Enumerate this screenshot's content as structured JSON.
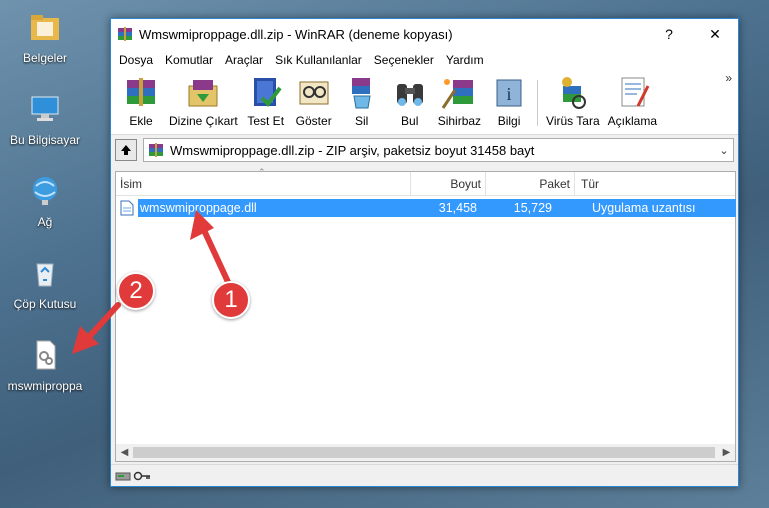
{
  "desktop": {
    "icons": [
      {
        "label": "Belgeler"
      },
      {
        "label": "Bu Bilgisayar"
      },
      {
        "label": "Ağ"
      },
      {
        "label": "Çöp Kutusu"
      },
      {
        "label": "mswmiproppa"
      }
    ]
  },
  "window": {
    "title": "Wmswmiproppage.dll.zip - WinRAR (deneme kopyası)",
    "help_btn": "?",
    "close_btn": "✕",
    "menu": [
      "Dosya",
      "Komutlar",
      "Araçlar",
      "Sık Kullanılanlar",
      "Seçenekler",
      "Yardım"
    ],
    "toolbar": [
      {
        "label": "Ekle",
        "icon": "add-icon"
      },
      {
        "label": "Dizine Çıkart",
        "icon": "extract-icon"
      },
      {
        "label": "Test Et",
        "icon": "test-icon"
      },
      {
        "label": "Göster",
        "icon": "view-icon"
      },
      {
        "label": "Sil",
        "icon": "delete-icon"
      },
      {
        "label": "Bul",
        "icon": "find-icon"
      },
      {
        "label": "Sihirbaz",
        "icon": "wizard-icon"
      },
      {
        "label": "Bilgi",
        "icon": "info-icon"
      },
      {
        "label": "Virüs Tara",
        "icon": "virus-scan-icon"
      },
      {
        "label": "Açıklama",
        "icon": "comment-icon"
      }
    ],
    "toolbar_more": "»",
    "address": "Wmswmiproppage.dll.zip - ZIP arşiv, paketsiz boyut 31458 bayt",
    "columns": {
      "name": "İsim",
      "size": "Boyut",
      "packed": "Paket",
      "type": "Tür"
    },
    "files": [
      {
        "name": "wmswmiproppage.dll",
        "size": "31,458",
        "packed": "15,729",
        "type": "Uygulama uzantısı"
      }
    ]
  },
  "annotations": {
    "badge1": "1",
    "badge2": "2",
    "color": "#e03a3a"
  }
}
